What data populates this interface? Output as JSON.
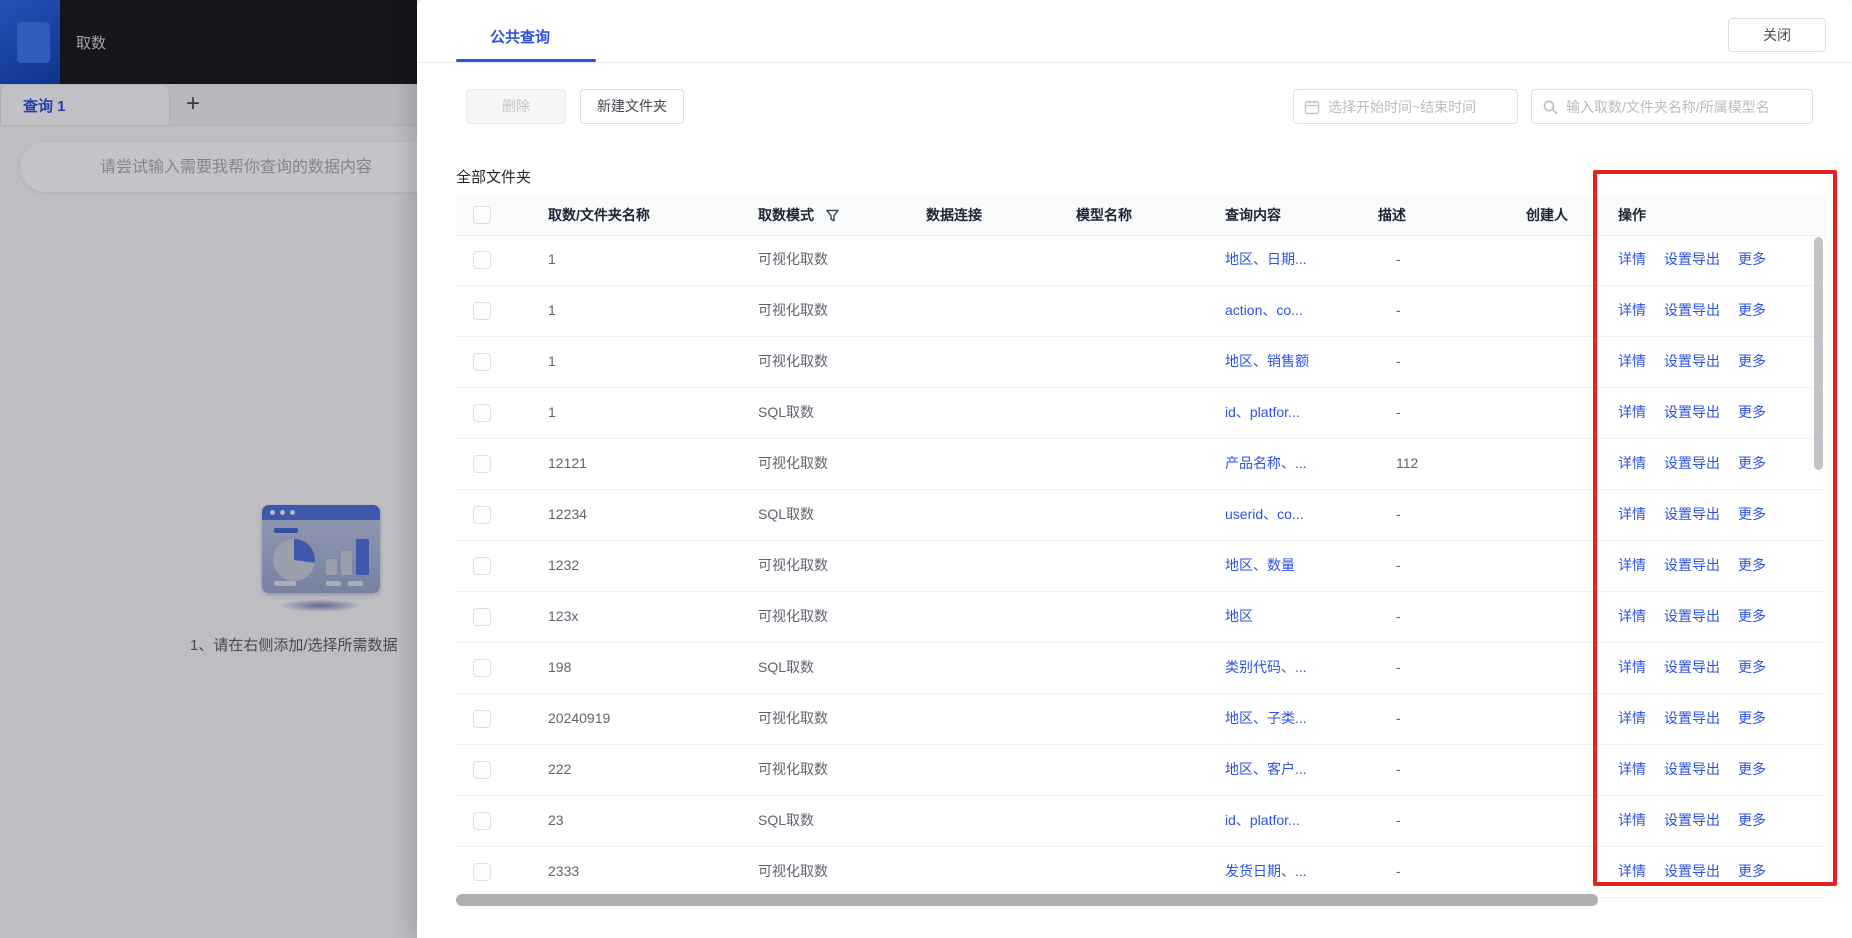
{
  "colors": {
    "accent_blue": "#2b53e3",
    "link_blue": "#2d52e8",
    "highlight_red": "#e7211c",
    "topbar_dark": "#17181b",
    "logo_blue": "#2e66e8"
  },
  "left_panel": {
    "app_title": "取数",
    "query_tab_label": "查询 1",
    "new_tab_icon": "+",
    "ai_search_placeholder": "请尝试输入需要我帮你查询的数据内容",
    "empty_hint": "1、请在右侧添加/选择所需数据",
    "illustration": "dashboard-window-with-pie-and-bar-charts"
  },
  "drawer": {
    "tab_label": "公共查询",
    "close_label": "关闭",
    "toolbar": {
      "delete_label": "删除",
      "new_folder_label": "新建文件夹",
      "date_range_placeholder": "选择开始时间~结束时间",
      "search_placeholder": "输入取数/文件夹名称/所属模型名",
      "calendar_icon": "calendar",
      "search_icon": "magnifier"
    },
    "section_label": "全部文件夹",
    "table": {
      "columns": [
        "取数/文件夹名称",
        "取数模式",
        "数据连接",
        "模型名称",
        "查询内容",
        "描述",
        "创建人",
        "操作"
      ],
      "filter_icon": "funnel",
      "action_labels": [
        "详情",
        "设置导出",
        "更多"
      ],
      "rows": [
        {
          "name": "1",
          "mode": "可视化取数",
          "connection": "",
          "model": "",
          "content": "地区、日期...",
          "desc": "-",
          "creator": ""
        },
        {
          "name": "1",
          "mode": "可视化取数",
          "connection": "",
          "model": "",
          "content": "action、co...",
          "desc": "-",
          "creator": ""
        },
        {
          "name": "1",
          "mode": "可视化取数",
          "connection": "",
          "model": "",
          "content": "地区、销售额",
          "desc": "-",
          "creator": ""
        },
        {
          "name": "1",
          "mode": "SQL取数",
          "connection": "",
          "model": "",
          "content": "id、platfor...",
          "desc": "-",
          "creator": ""
        },
        {
          "name": "12121",
          "mode": "可视化取数",
          "connection": "",
          "model": "",
          "content": "产品名称、...",
          "desc": "112",
          "creator": ""
        },
        {
          "name": "12234",
          "mode": "SQL取数",
          "connection": "",
          "model": "",
          "content": "userid、co...",
          "desc": "-",
          "creator": ""
        },
        {
          "name": "1232",
          "mode": "可视化取数",
          "connection": "",
          "model": "",
          "content": "地区、数量",
          "desc": "-",
          "creator": ""
        },
        {
          "name": "123x",
          "mode": "可视化取数",
          "connection": "",
          "model": "",
          "content": "地区",
          "desc": "-",
          "creator": ""
        },
        {
          "name": "198",
          "mode": "SQL取数",
          "connection": "",
          "model": "",
          "content": "类别代码、...",
          "desc": "-",
          "creator": ""
        },
        {
          "name": "20240919",
          "mode": "可视化取数",
          "connection": "",
          "model": "",
          "content": "地区、子类...",
          "desc": "-",
          "creator": ""
        },
        {
          "name": "222",
          "mode": "可视化取数",
          "connection": "",
          "model": "",
          "content": "地区、客户...",
          "desc": "-",
          "creator": ""
        },
        {
          "name": "23",
          "mode": "SQL取数",
          "connection": "",
          "model": "",
          "content": "id、platfor...",
          "desc": "-",
          "creator": ""
        },
        {
          "name": "2333",
          "mode": "可视化取数",
          "connection": "",
          "model": "",
          "content": "发货日期、...",
          "desc": "-",
          "creator": ""
        }
      ]
    }
  }
}
